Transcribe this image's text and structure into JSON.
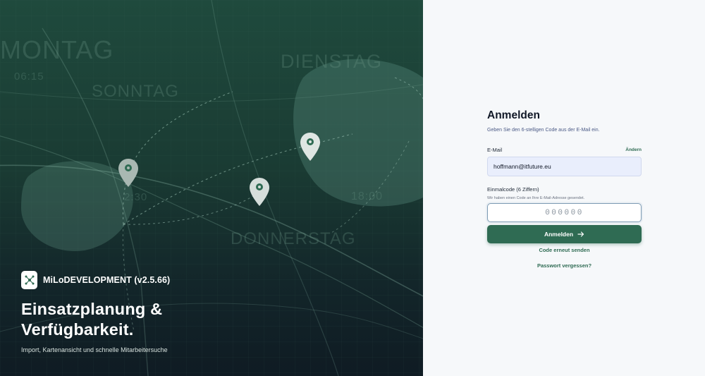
{
  "hero": {
    "background_words": [
      "MONTAG",
      "DIENSTAG",
      "SONNTAG",
      "06:15",
      "DONNERSTAG",
      "18:00",
      "2:30"
    ],
    "app_name": "MiLoDEVELOPMENT (v2.5.66)",
    "title_line1": "Einsatzplanung &",
    "title_line2": "Verfügbarkeit.",
    "subtitle": "Import, Kartenansicht und schnelle Mitarbeitersuche"
  },
  "login": {
    "title": "Anmelden",
    "subtitle": "Geben Sie den 6-stelligen Code aus der E-Mail ein.",
    "email_label": "E-Mail",
    "change_link": "Ändern",
    "email_value": "hoffmann@itfuture.eu",
    "code_label": "Einmalcode (6 Ziffern)",
    "code_hint": "Wir haben einen Code an Ihre E-Mail-Adresse gesendet.",
    "code_placeholder": "000000",
    "submit_label": "Anmelden",
    "resend_label": "Code erneut senden",
    "forgot_label": "Passwort vergessen?"
  },
  "colors": {
    "accent": "#2f6b53",
    "hero_top": "#1f4a3d",
    "hero_bottom": "#0f1b23",
    "panel_bg": "#f6f8fa"
  },
  "icons": {
    "logo": "network-nodes-icon",
    "pins": "map-pin-icon",
    "submit": "arrow-right-icon"
  }
}
